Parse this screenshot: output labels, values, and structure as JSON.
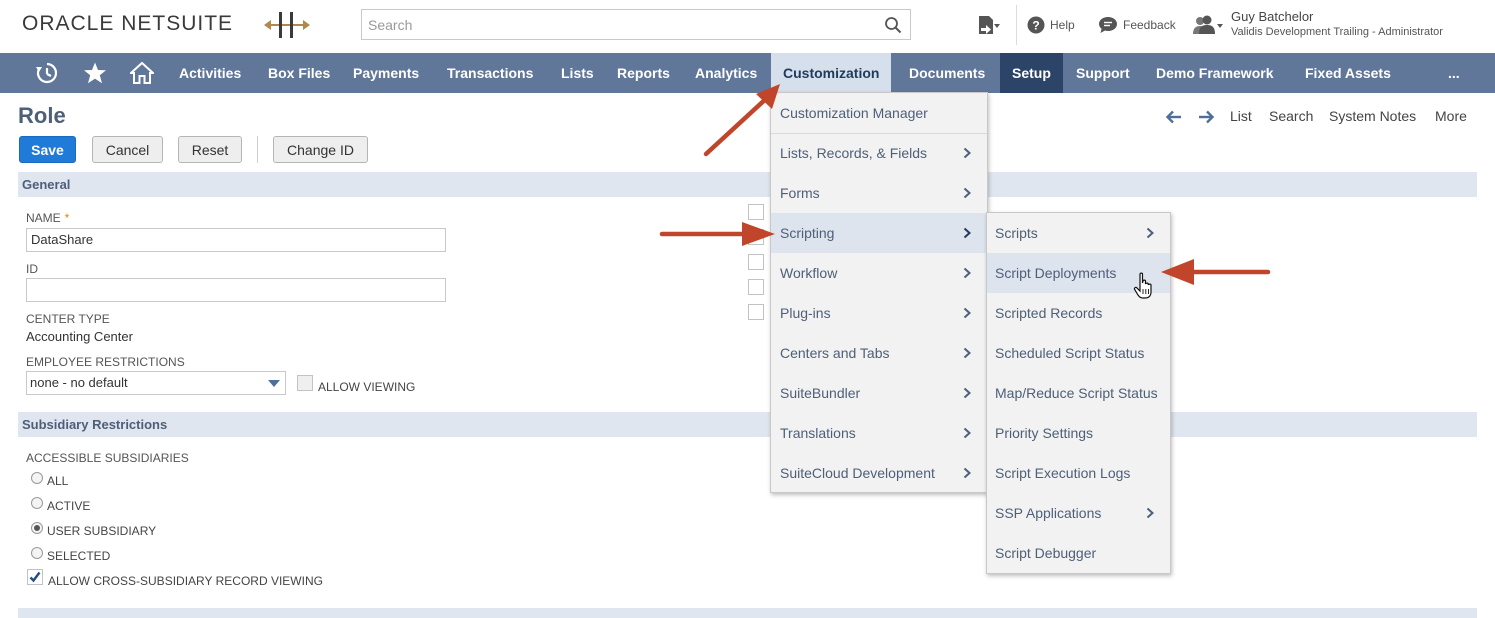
{
  "header": {
    "logo_oracle": "ORACLE",
    "logo_netsuite": "NETSUITE",
    "search_placeholder": "Search",
    "help_label": "Help",
    "feedback_label": "Feedback",
    "user_name": "Guy Batchelor",
    "user_role": "Validis Development Trailing - Administrator"
  },
  "nav": {
    "items": [
      "Activities",
      "Box Files",
      "Payments",
      "Transactions",
      "Lists",
      "Reports",
      "Analytics",
      "Customization",
      "Documents",
      "Setup",
      "Support",
      "Demo Framework",
      "Fixed Assets"
    ],
    "more": "...",
    "active": "Customization"
  },
  "page": {
    "title": "Role",
    "buttons": {
      "save": "Save",
      "cancel": "Cancel",
      "reset": "Reset",
      "change_id": "Change ID"
    },
    "right_links": {
      "list": "List",
      "search": "Search",
      "system_notes": "System Notes",
      "more": "More"
    }
  },
  "general": {
    "section_title": "General",
    "name_label": "NAME",
    "name_required": "*",
    "name_value": "DataShare",
    "id_label": "ID",
    "id_value": "",
    "center_type_label": "CENTER TYPE",
    "center_type_value": "Accounting Center",
    "employee_restrictions_label": "EMPLOYEE RESTRICTIONS",
    "employee_restrictions_value": "none - no default",
    "allow_viewing_label": "ALLOW VIEWING"
  },
  "subsidiary": {
    "section_title": "Subsidiary Restrictions",
    "accessible_label": "ACCESSIBLE SUBSIDIARIES",
    "options": [
      "ALL",
      "ACTIVE",
      "USER SUBSIDIARY",
      "SELECTED"
    ],
    "selected_option": "USER SUBSIDIARY",
    "cross_sub_label": "ALLOW CROSS-SUBSIDIARY RECORD VIEWING",
    "cross_sub_checked": true
  },
  "customization_menu": {
    "items": [
      "Customization Manager",
      "Lists, Records, & Fields",
      "Forms",
      "Scripting",
      "Workflow",
      "Plug-ins",
      "Centers and Tabs",
      "SuiteBundler",
      "Translations",
      "SuiteCloud Development"
    ],
    "highlighted": "Scripting"
  },
  "scripting_menu": {
    "items": [
      "Scripts",
      "Script Deployments",
      "Scripted Records",
      "Scheduled Script Status",
      "Map/Reduce Script Status",
      "Priority Settings",
      "Script Execution Logs",
      "SSP Applications",
      "Script Debugger"
    ],
    "highlighted": "Script Deployments"
  },
  "colors": {
    "nav_bg": "#607799",
    "nav_active_bg": "#d6e0ec",
    "setup_bg": "#2c4468",
    "primary_button": "#1f7ad8",
    "section_bg": "#e0e6ef",
    "annotation_arrow": "#c0452a"
  }
}
